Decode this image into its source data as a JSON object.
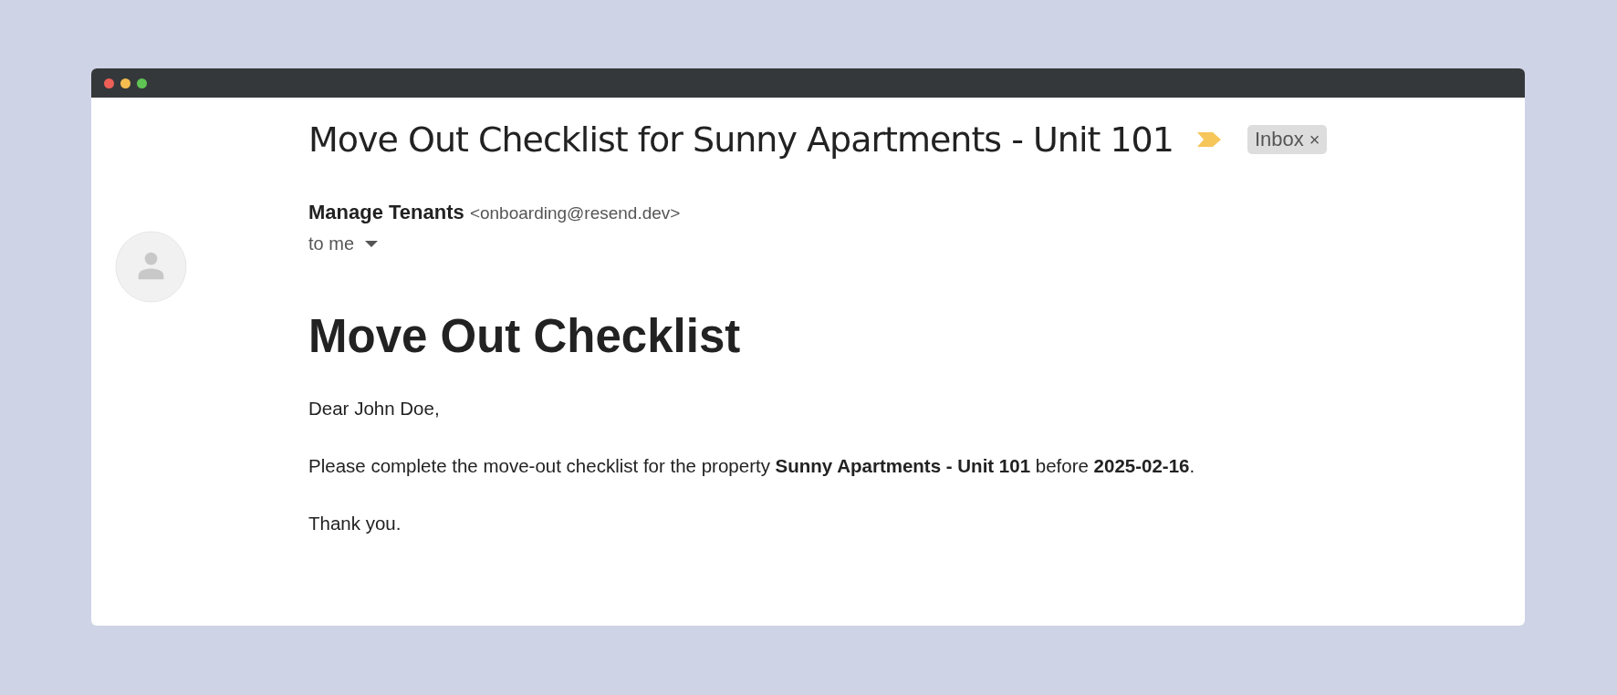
{
  "window": {
    "controls": [
      {
        "color": "#ed5f57"
      },
      {
        "color": "#f5bd4f"
      },
      {
        "color": "#5fc454"
      }
    ]
  },
  "subject": "Move Out Checklist for Sunny Apartments - Unit 101",
  "important": true,
  "label": {
    "text": "Inbox",
    "close": "×"
  },
  "sender": {
    "name": "Manage Tenants",
    "email": "<onboarding@resend.dev>",
    "recipient": "to me"
  },
  "body": {
    "heading": "Move Out Checklist",
    "paragraphs": [
      "Dear John Doe,",
      "Please complete the move-out checklist for the property **Sunny Apartments - Unit 101** before **2025-02-16**.",
      "Thank you."
    ]
  }
}
